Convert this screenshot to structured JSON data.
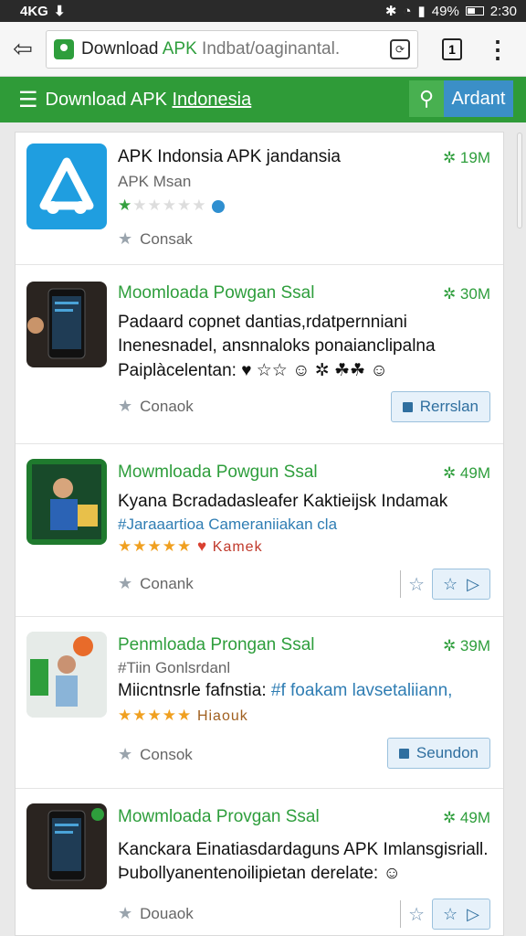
{
  "statusbar": {
    "network": "4KG",
    "battery": "49%",
    "time": "2:30"
  },
  "browser": {
    "url_prefix": "Download ",
    "url_highlight": "APK",
    "url_rest": " Indbat/oaginantal.",
    "tabs_count": "1"
  },
  "site": {
    "title_plain": "Download APK ",
    "title_underlined": "Indonesia",
    "action_button": "Ardant"
  },
  "items": [
    {
      "title": "APK Indonsia APK jandansia",
      "size": "✲ 19M",
      "subtitle": "APK Msan",
      "footer": "Consak"
    },
    {
      "title": "Moomloada Powgan Ssal",
      "size": "✲ 30M",
      "line1": "Padaard copnet dantias,rdatpernniani",
      "line2": "Inenesnadel, ansnnaloks ponaianclipalna",
      "line3": "Paiplàcelentan: ♥ ☆☆ ☺ ✲ ☘☘ ☺",
      "footer": "Conaok",
      "button": "Rerrslan"
    },
    {
      "title": "Mowmloada Powgun Ssal",
      "size": "✲ 49M",
      "line1": "Kyana Bcradadasleafer Kaktieijsk Indamak",
      "line2": "#Jaraaartioa Cameraniiakan cla",
      "tag": "Kamek",
      "footer": "Conank"
    },
    {
      "title": "Penmloada Prongan Ssal",
      "size": "✲ 39M",
      "line1": "#Tiin Gonlsrdanl",
      "line2_plain": "Miicntnsrle fafnstia: ",
      "line2_link": "#f foakam lavsetaliiann,",
      "tag": "Hiaouk",
      "footer": "Consok",
      "button": "Seundon"
    },
    {
      "title": "Mowmloada Provgan Ssal",
      "size": "✲ 49M",
      "line1": "Kanckara Einatiasdardaguns APK Imlansgisriall.",
      "line2": "Þubollyanentenoilipietan derelate: ☺",
      "footer": "Douaok"
    }
  ]
}
